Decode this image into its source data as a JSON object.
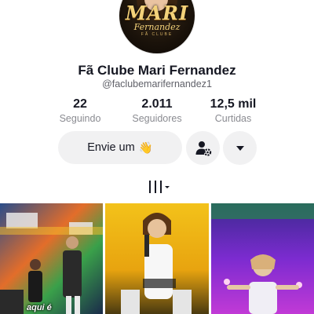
{
  "profile": {
    "avatar_logo": "MARI",
    "avatar_logo_sub": "Fernandez",
    "avatar_logo_tag": "FÃ CLUBE",
    "name": "Fã Clube Mari Fernandez",
    "handle": "@faclubemarifernandez1"
  },
  "stats": [
    {
      "value": "22",
      "label": "Seguindo"
    },
    {
      "value": "2.011",
      "label": "Seguidores"
    },
    {
      "value": "12,5 mil",
      "label": "Curtidas"
    }
  ],
  "actions": {
    "message_label": "Envie um",
    "message_emoji": "👋",
    "add_friend_icon": "person-gear-icon",
    "more_icon": "caret-down-icon"
  },
  "tabs": {
    "grid_icon": "grid-bars-icon"
  },
  "videos": [
    {
      "caption": "aqui é"
    },
    {
      "caption": ""
    },
    {
      "caption": ""
    }
  ],
  "colors": {
    "button_bg": "#f1f1f2",
    "text_primary": "#161823",
    "text_secondary": "#8a8b91"
  }
}
